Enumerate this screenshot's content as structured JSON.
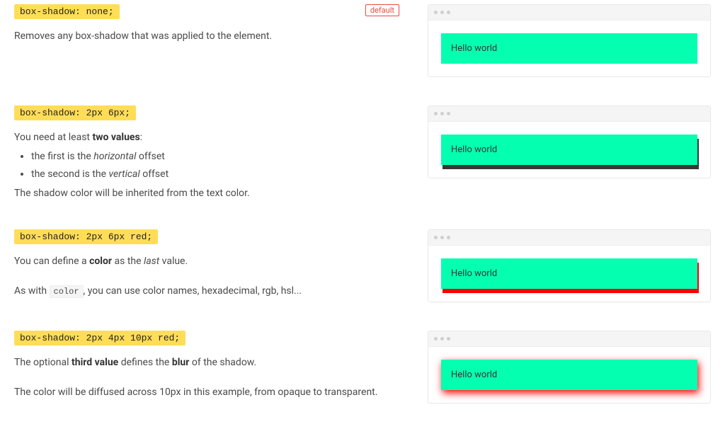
{
  "default_badge": "default",
  "examples": [
    {
      "code": "box-shadow: none;",
      "is_default": true,
      "hello": "Hello world",
      "desc_html": "Removes any box-shadow that was applied to the element."
    },
    {
      "code": "box-shadow: 2px 6px;",
      "is_default": false,
      "hello": "Hello world",
      "desc_html": "You need at least <strong>two values</strong>:<ul><li>the first is the <em>horizontal</em> offset</li><li>the second is the <em>vertical</em> offset</li></ul>The shadow color will be inherited from the text color."
    },
    {
      "code": "box-shadow: 2px 6px red;",
      "is_default": false,
      "hello": "Hello world",
      "desc_html": "You can define a <strong>color</strong> as the <em>last</em> value.<br><br>As with <code class='inline'>color</code>, you can use color names, hexadecimal, rgb, hsl..."
    },
    {
      "code": "box-shadow: 2px 4px 10px red;",
      "is_default": false,
      "hello": "Hello world",
      "desc_html": "The optional <strong>third value</strong> defines the <strong>blur</strong> of the shadow.<br><br>The color will be diffused across 10px in this example, from opaque to transparent."
    }
  ]
}
